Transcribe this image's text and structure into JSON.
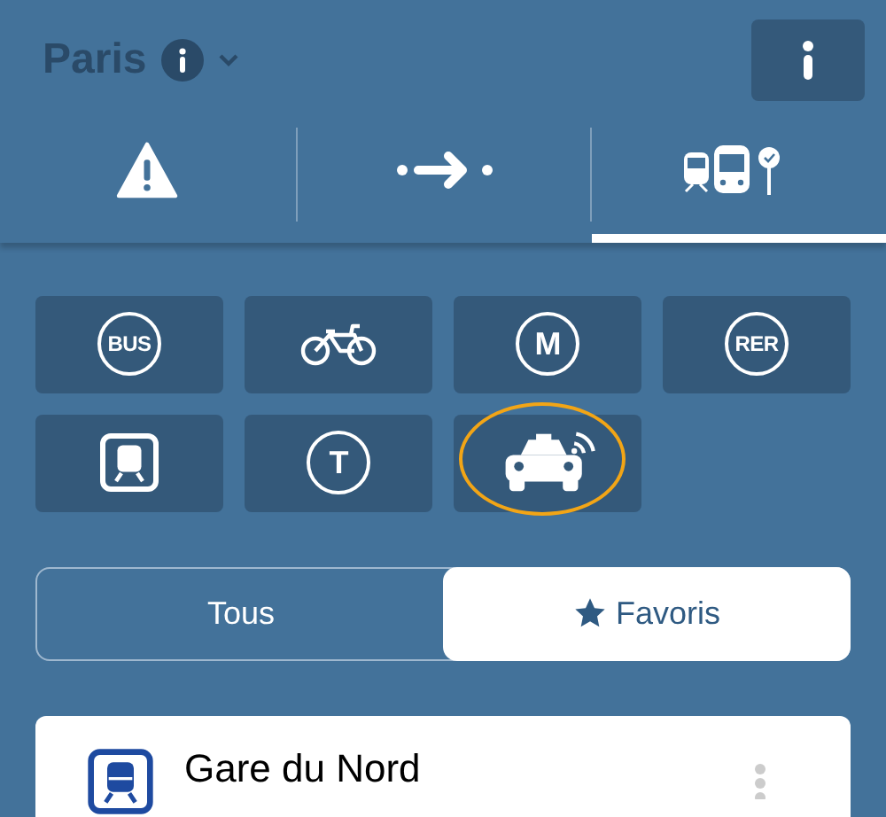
{
  "header": {
    "city": "Paris"
  },
  "tabs": [
    {
      "kind": "alert",
      "selected": false
    },
    {
      "kind": "route",
      "selected": false
    },
    {
      "kind": "stops",
      "selected": true
    }
  ],
  "modes": [
    {
      "kind": "circle",
      "label": "BUS",
      "highlighted": false
    },
    {
      "kind": "bike",
      "highlighted": false
    },
    {
      "kind": "circle",
      "label": "M",
      "highlighted": false
    },
    {
      "kind": "circle",
      "label": "RER",
      "highlighted": false
    },
    {
      "kind": "train",
      "highlighted": false
    },
    {
      "kind": "circle",
      "label": "T",
      "highlighted": false
    },
    {
      "kind": "taxi",
      "highlighted": true
    }
  ],
  "filter": [
    {
      "label": "Tous",
      "star": false,
      "selected": false
    },
    {
      "label": "Favoris",
      "star": true,
      "selected": true
    }
  ],
  "stations": [
    {
      "name": "Gare du Nord"
    }
  ]
}
